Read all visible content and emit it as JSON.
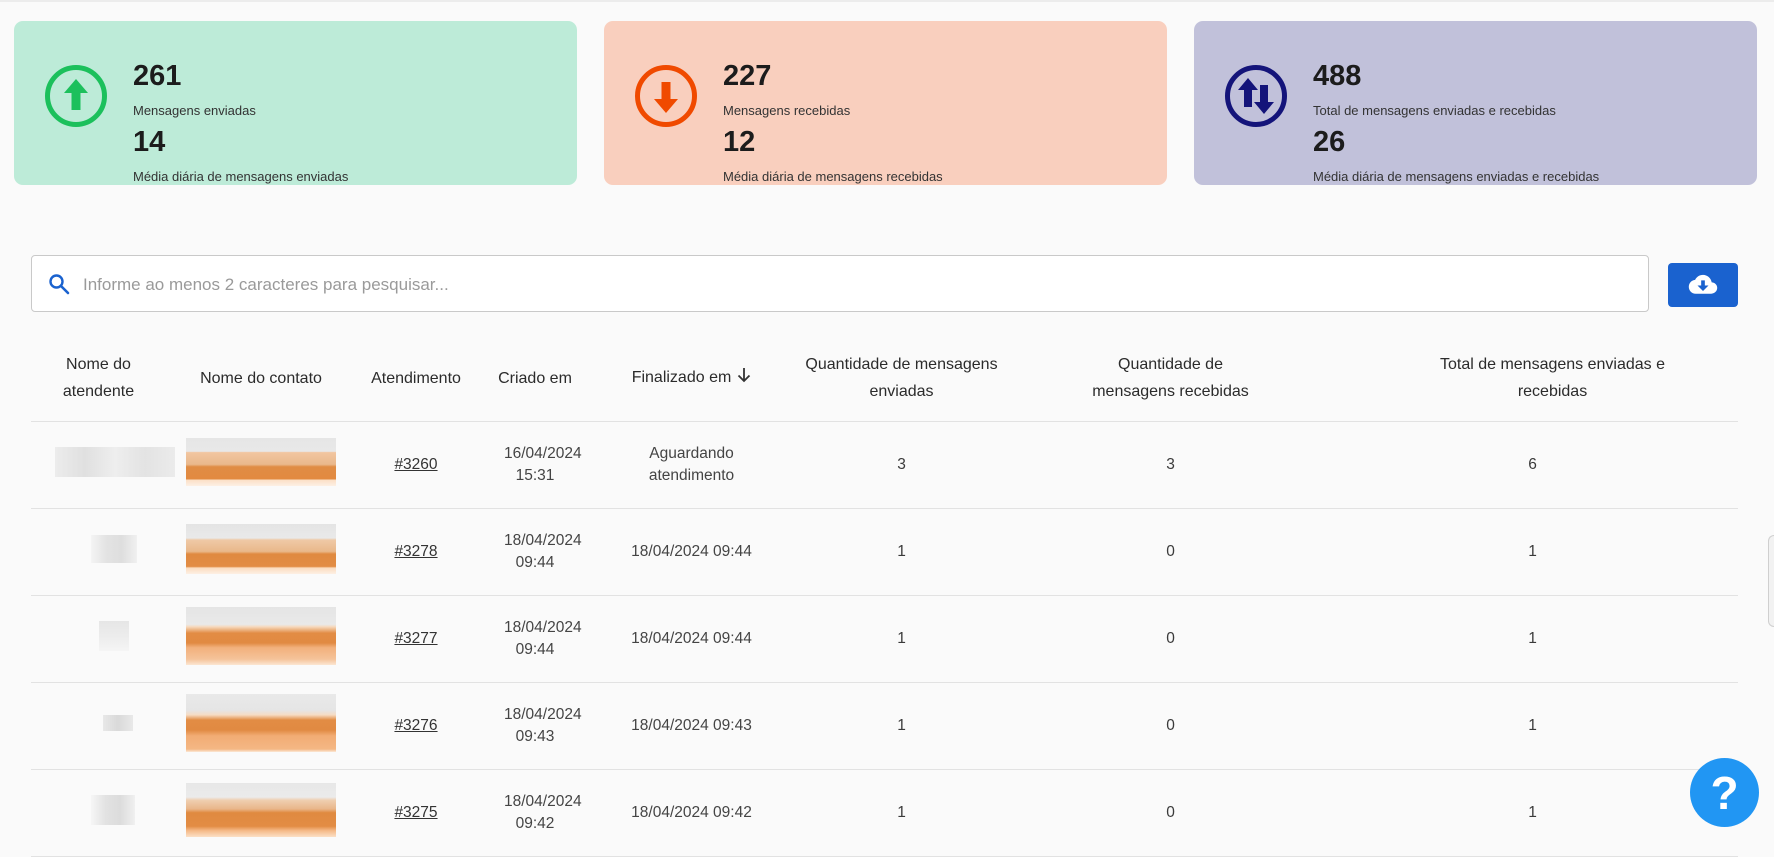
{
  "cards": [
    {
      "number1": "261",
      "label1": "Mensagens enviadas",
      "number2": "14",
      "label2": "Média diária de mensagens enviadas",
      "bg": "#bdebd8",
      "accent": "#1cc05c",
      "icon": "arrow-up-circle-icon"
    },
    {
      "number1": "227",
      "label1": "Mensagens recebidas",
      "number2": "12",
      "label2": "Média diária de mensagens recebidas",
      "bg": "#f9cfbe",
      "accent": "#f04a00",
      "icon": "arrow-down-circle-icon"
    },
    {
      "number1": "488",
      "label1": "Total de mensagens enviadas e recebidas",
      "number2": "26",
      "label2": "Média diária de mensagens enviadas e recebidas",
      "bg": "#c1c1da",
      "accent": "#14147a",
      "icon": "swap-vertical-circle-icon"
    }
  ],
  "search": {
    "placeholder": "Informe ao menos 2 caracteres para pesquisar...",
    "value": ""
  },
  "download_button": {
    "icon": "cloud-download-icon",
    "color": "#1a62cf"
  },
  "table": {
    "headers": {
      "agent": "Nome do atendente",
      "contact": "Nome do contato",
      "ticket": "Atendimento",
      "created": "Criado em",
      "finished": "Finalizado em",
      "sent": "Quantidade de mensagens enviadas",
      "received": "Quantidade de mensagens recebidas",
      "total": "Total de mensagens enviadas e recebidas"
    },
    "sort_icon": "arrow-down-icon",
    "rows": [
      {
        "ticket": "#3260",
        "created": "16/04/2024 15:31",
        "finished": "Aguardando atendimento",
        "sent": "3",
        "received": "3",
        "total": "6"
      },
      {
        "ticket": "#3278",
        "created": "18/04/2024 09:44",
        "finished": "18/04/2024 09:44",
        "sent": "1",
        "received": "0",
        "total": "1"
      },
      {
        "ticket": "#3277",
        "created": "18/04/2024 09:44",
        "finished": "18/04/2024 09:44",
        "sent": "1",
        "received": "0",
        "total": "1"
      },
      {
        "ticket": "#3276",
        "created": "18/04/2024 09:43",
        "finished": "18/04/2024 09:43",
        "sent": "1",
        "received": "0",
        "total": "1"
      },
      {
        "ticket": "#3275",
        "created": "18/04/2024 09:42",
        "finished": "18/04/2024 09:42",
        "sent": "1",
        "received": "0",
        "total": "1"
      }
    ]
  },
  "help_button": {
    "label": "?",
    "color": "#2196f3"
  }
}
